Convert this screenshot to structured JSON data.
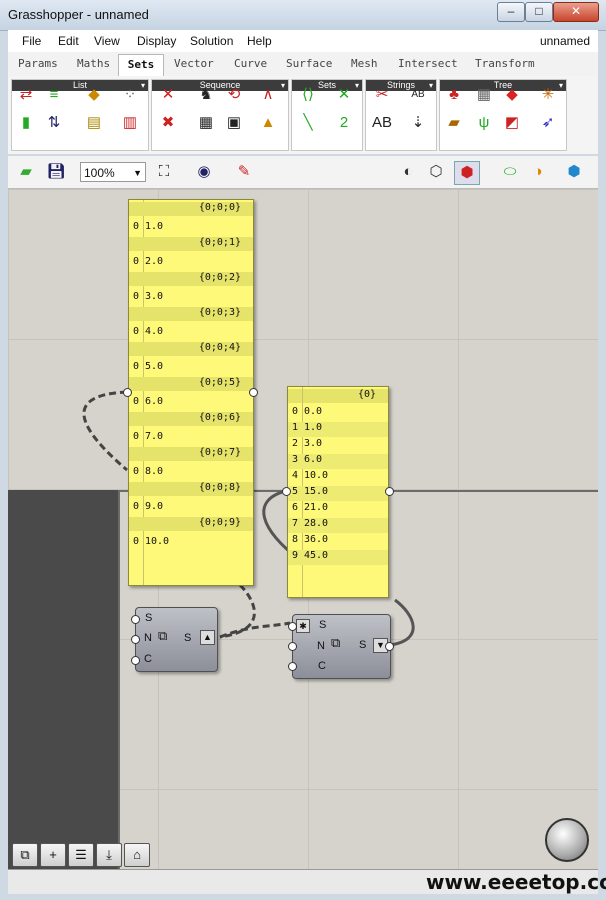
{
  "window": {
    "title": "Grasshopper - unnamed",
    "minimize": "–",
    "maximize": "□",
    "close": "✕"
  },
  "menu": [
    "File",
    "Edit",
    "View",
    "Display",
    "Solution",
    "Help"
  ],
  "document_name": "unnamed",
  "tabs": [
    "Params",
    "Maths",
    "Sets",
    "Vector",
    "Curve",
    "Surface",
    "Mesh",
    "Intersect",
    "Transform"
  ],
  "active_tab": "Sets",
  "ribbon_groups": [
    "List",
    "Sequence",
    "Sets",
    "Strings",
    "Tree"
  ],
  "zoom": "100%",
  "panel_left": {
    "branches": [
      {
        "path": "{0;0;0}",
        "index": "0",
        "value": "1.0"
      },
      {
        "path": "{0;0;1}",
        "index": "0",
        "value": "2.0"
      },
      {
        "path": "{0;0;2}",
        "index": "0",
        "value": "3.0"
      },
      {
        "path": "{0;0;3}",
        "index": "0",
        "value": "4.0"
      },
      {
        "path": "{0;0;4}",
        "index": "0",
        "value": "5.0"
      },
      {
        "path": "{0;0;5}",
        "index": "0",
        "value": "6.0"
      },
      {
        "path": "{0;0;6}",
        "index": "0",
        "value": "7.0"
      },
      {
        "path": "{0;0;7}",
        "index": "0",
        "value": "8.0"
      },
      {
        "path": "{0;0;8}",
        "index": "0",
        "value": "9.0"
      },
      {
        "path": "{0;0;9}",
        "index": "0",
        "value": "10.0"
      }
    ]
  },
  "panel_right": {
    "path": "{0}",
    "items": [
      {
        "index": "0",
        "value": "0.0"
      },
      {
        "index": "1",
        "value": "1.0"
      },
      {
        "index": "2",
        "value": "3.0"
      },
      {
        "index": "3",
        "value": "6.0"
      },
      {
        "index": "4",
        "value": "10.0"
      },
      {
        "index": "5",
        "value": "15.0"
      },
      {
        "index": "6",
        "value": "21.0"
      },
      {
        "index": "7",
        "value": "28.0"
      },
      {
        "index": "8",
        "value": "36.0"
      },
      {
        "index": "9",
        "value": "45.0"
      }
    ]
  },
  "component_left": {
    "inputs": [
      "S",
      "N",
      "C"
    ],
    "output": "S"
  },
  "component_right": {
    "inputs": [
      "S",
      "N",
      "C"
    ],
    "output": "S"
  },
  "watermark": "www.eeeetop.com"
}
